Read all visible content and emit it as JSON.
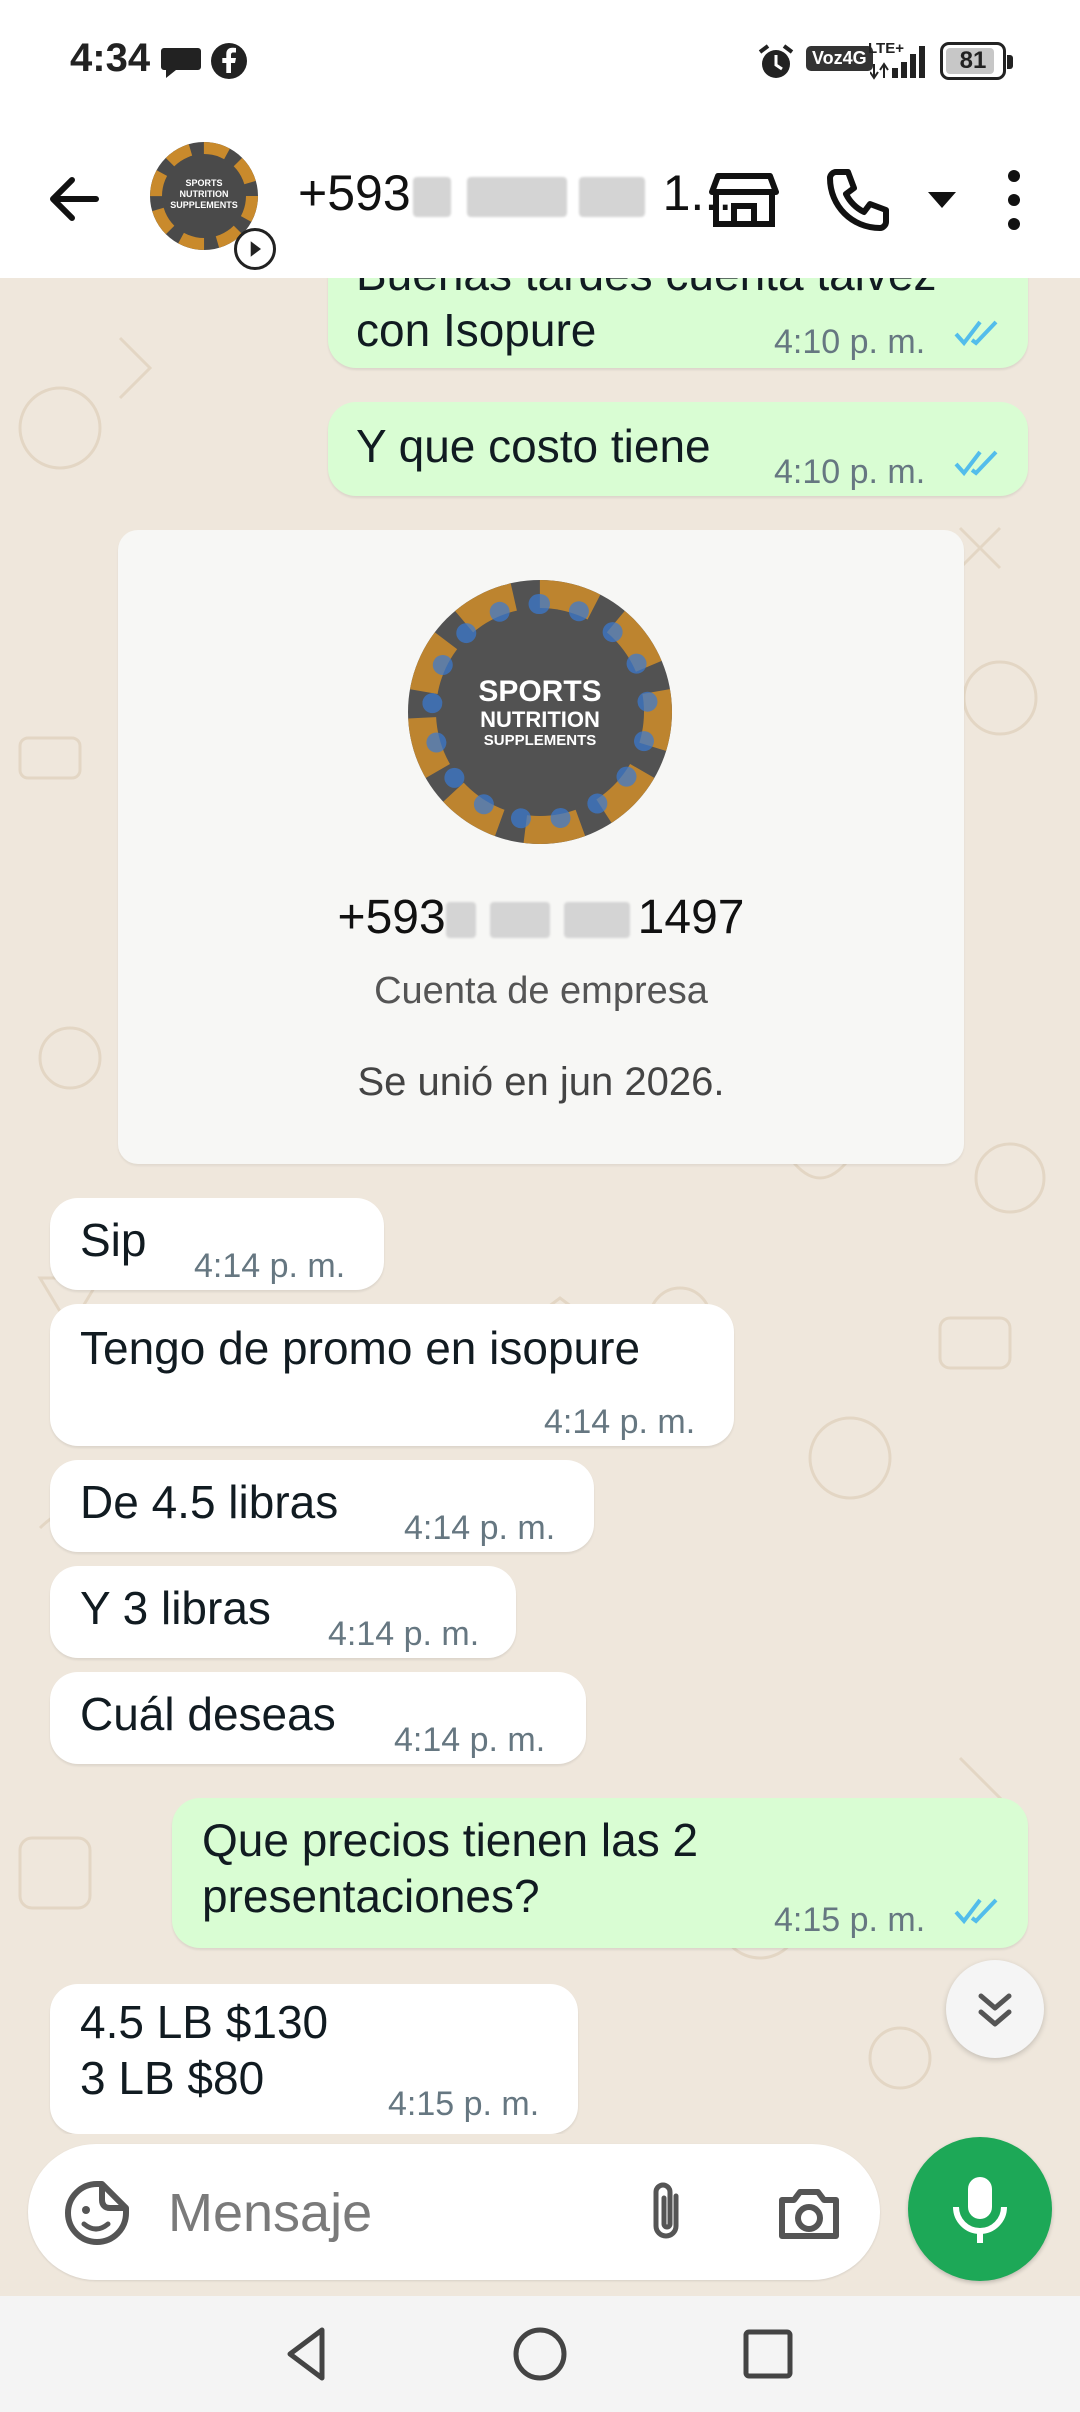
{
  "status_bar": {
    "time": "4:34",
    "network_badge": "Voz4G",
    "lte_label": "LTE+",
    "battery": "81"
  },
  "header": {
    "contact_title": "+593",
    "title_suffix": "1..."
  },
  "messages": [
    {
      "dir": "out",
      "text_lines": [
        "Buenas tardes cuenta talvez",
        "con Isopure"
      ],
      "time": "4:10 p. m."
    },
    {
      "dir": "out",
      "text_lines": [
        "Y que costo tiene"
      ],
      "time": "4:10 p. m."
    },
    {
      "dir": "in",
      "text_lines": [
        "Sip"
      ],
      "time": "4:14 p. m."
    },
    {
      "dir": "in",
      "text_lines": [
        "Tengo de promo en isopure"
      ],
      "time": "4:14 p. m."
    },
    {
      "dir": "in",
      "text_lines": [
        "De 4.5 libras"
      ],
      "time": "4:14 p. m."
    },
    {
      "dir": "in",
      "text_lines": [
        "Y 3 libras"
      ],
      "time": "4:14 p. m."
    },
    {
      "dir": "in",
      "text_lines": [
        "Cuál deseas"
      ],
      "time": "4:14 p. m."
    },
    {
      "dir": "out",
      "text_lines": [
        "Que precios tienen las 2",
        "presentaciones?"
      ],
      "time": "4:15 p. m."
    },
    {
      "dir": "in",
      "text_lines": [
        "4.5 LB $130",
        "3 LB $80"
      ],
      "time": "4:15 p. m."
    }
  ],
  "business_card": {
    "logo_line1": "SPORTS",
    "logo_line2": "NUTRITION",
    "logo_line3": "SUPPLEMENTS",
    "phone_prefix": "+593",
    "phone_suffix": "1497",
    "account_type": "Cuenta de empresa",
    "joined": "Se unió en jun 2026."
  },
  "input": {
    "placeholder": "Mensaje"
  },
  "colors": {
    "outgoing_bubble": "#d9fdd3",
    "incoming_bubble": "#ffffff",
    "chat_bg": "#efe7dc",
    "mic_button": "#1da857",
    "read_ticks": "#53bdeb"
  },
  "icons": [
    "back-arrow-icon",
    "status-icon",
    "store-icon",
    "phone-icon",
    "dropdown-icon",
    "more-icon",
    "sticker-icon",
    "attach-icon",
    "camera-icon",
    "mic-icon",
    "scroll-down-icon",
    "nav-back-icon",
    "nav-home-icon",
    "nav-recents-icon"
  ]
}
